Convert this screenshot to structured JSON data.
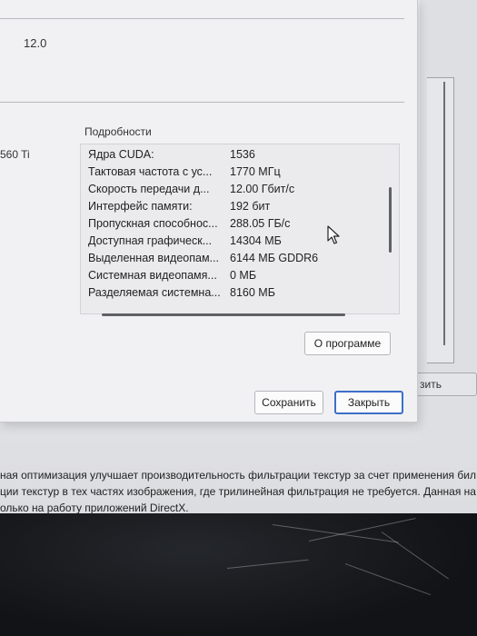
{
  "version_value": "12.0",
  "side_fragment": "560 Ti",
  "details": {
    "header": "Подробности",
    "rows": [
      {
        "label": "Ядра CUDA:",
        "value": "1536"
      },
      {
        "label": "Тактовая частота с ус...",
        "value": "1770 МГц"
      },
      {
        "label": "Скорость передачи д...",
        "value": "12.00 Гбит/с"
      },
      {
        "label": "Интерфейс памяти:",
        "value": "192 бит"
      },
      {
        "label": "Пропускная способнос...",
        "value": "288.05 ГБ/с"
      },
      {
        "label": "Доступная графическ...",
        "value": "14304 МБ"
      },
      {
        "label": "Выделенная видеопам...",
        "value": "6144 МБ GDDR6"
      },
      {
        "label": "Системная видеопамя...",
        "value": "0 МБ"
      },
      {
        "label": "Разделяемая системна...",
        "value": "8160 МБ"
      }
    ]
  },
  "buttons": {
    "about": "О программе",
    "save": "Сохранить",
    "close": "Закрыть",
    "apply_fragment": "зить"
  },
  "description": {
    "line1": "ная оптимизация улучшает производительность фильтрации текстур за счет применения бил",
    "line2": "ции текстур в тех частях изображения, где трилинейная фильтрация не требуется. Данная на",
    "line3": "олько на работу приложений DirectX."
  }
}
